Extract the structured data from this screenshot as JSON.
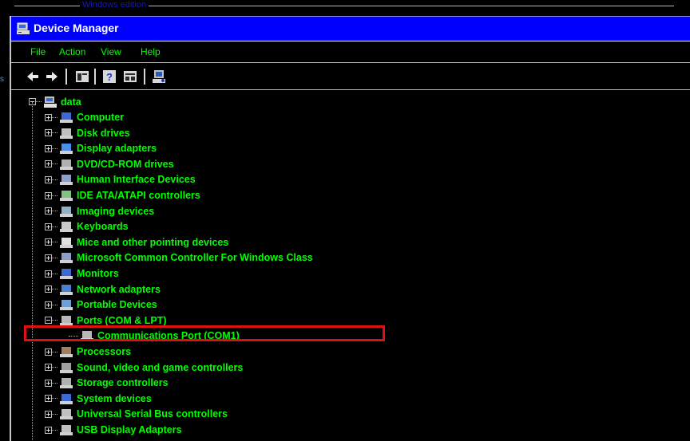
{
  "top_caption": "Windows edition",
  "left_edge_char": "s",
  "window": {
    "title": "Device Manager",
    "menus": [
      "File",
      "Action",
      "View",
      "Help"
    ],
    "toolbar": [
      "back-icon",
      "forward-icon",
      "properties-icon",
      "help-icon",
      "show-hidden-icon",
      "scan-hardware-icon"
    ]
  },
  "tree": {
    "root": "data",
    "categories": [
      {
        "label": "Computer",
        "icon": "computer-icon",
        "expanded": false
      },
      {
        "label": "Disk drives",
        "icon": "disk-drive-icon",
        "expanded": false
      },
      {
        "label": "Display adapters",
        "icon": "display-adapter-icon",
        "expanded": false
      },
      {
        "label": "DVD/CD-ROM drives",
        "icon": "dvd-drive-icon",
        "expanded": false
      },
      {
        "label": "Human Interface Devices",
        "icon": "hid-icon",
        "expanded": false
      },
      {
        "label": "IDE ATA/ATAPI controllers",
        "icon": "ide-controller-icon",
        "expanded": false
      },
      {
        "label": "Imaging devices",
        "icon": "imaging-device-icon",
        "expanded": false
      },
      {
        "label": "Keyboards",
        "icon": "keyboard-icon",
        "expanded": false
      },
      {
        "label": "Mice and other pointing devices",
        "icon": "mouse-icon",
        "expanded": false
      },
      {
        "label": "Microsoft Common Controller For Windows Class",
        "icon": "controller-icon",
        "expanded": false
      },
      {
        "label": "Monitors",
        "icon": "monitor-icon",
        "expanded": false
      },
      {
        "label": "Network adapters",
        "icon": "network-adapter-icon",
        "expanded": false
      },
      {
        "label": "Portable Devices",
        "icon": "portable-device-icon",
        "expanded": false
      },
      {
        "label": "Ports (COM & LPT)",
        "icon": "port-icon",
        "expanded": true,
        "children": [
          {
            "label": "Communications Port (COM1)",
            "icon": "port-icon",
            "highlighted": true
          }
        ]
      },
      {
        "label": "Processors",
        "icon": "processor-icon",
        "expanded": false
      },
      {
        "label": "Sound, video and game controllers",
        "icon": "sound-icon",
        "expanded": false
      },
      {
        "label": "Storage controllers",
        "icon": "storage-controller-icon",
        "expanded": false
      },
      {
        "label": "System devices",
        "icon": "system-device-icon",
        "expanded": false
      },
      {
        "label": "Universal Serial Bus controllers",
        "icon": "usb-icon",
        "expanded": false
      },
      {
        "label": "USB Display Adapters",
        "icon": "usb-display-icon",
        "expanded": false
      }
    ]
  },
  "colors": {
    "titlebar": "#0000ff",
    "text": "#00ff00",
    "background": "#000000",
    "highlight_box": "#e01010"
  }
}
